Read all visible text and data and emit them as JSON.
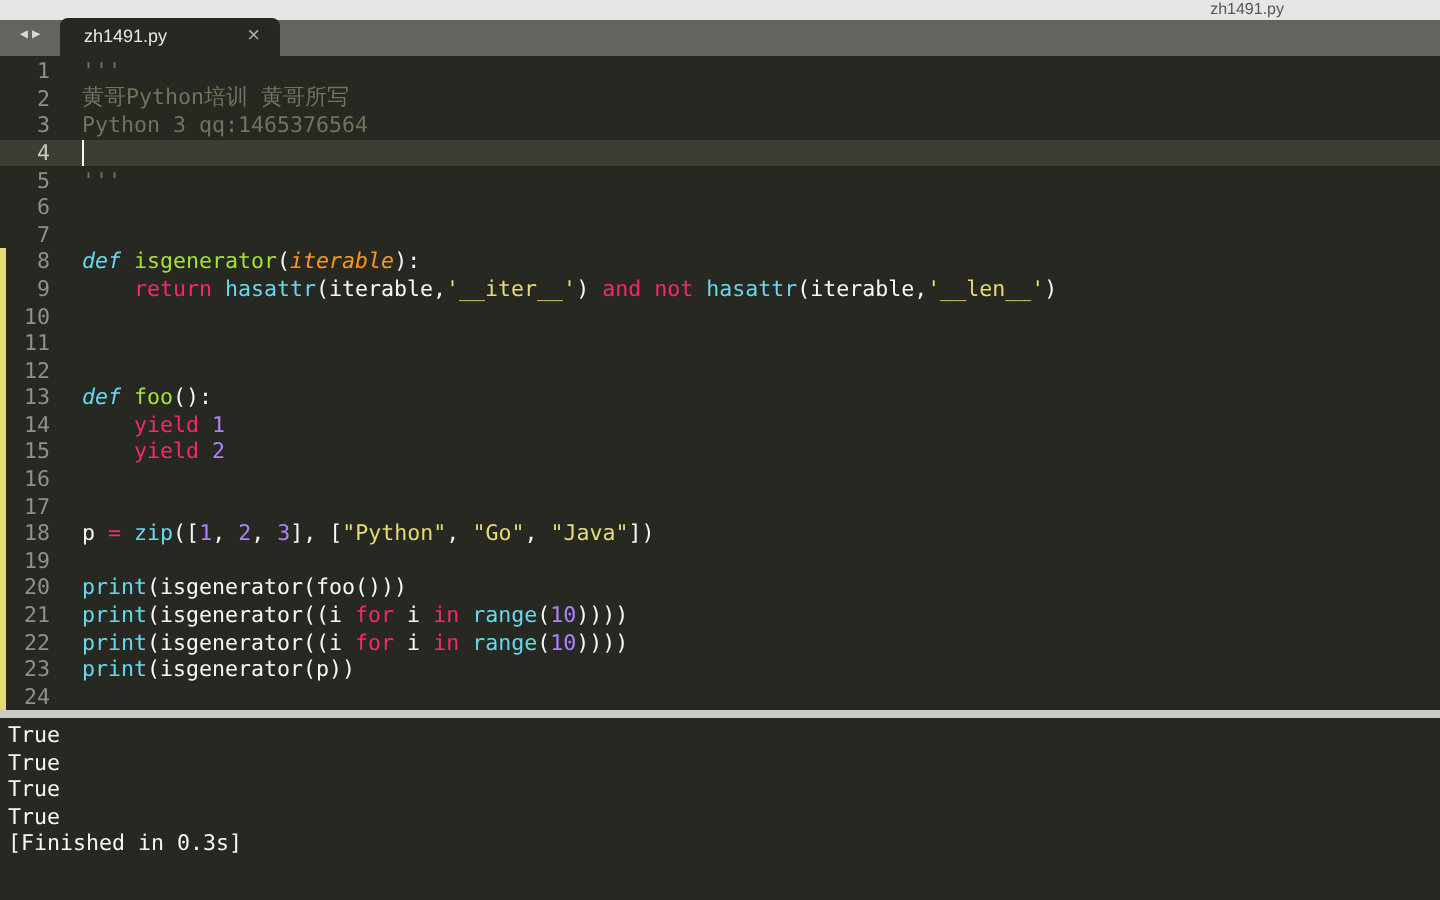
{
  "window": {
    "title": "zh1491.py"
  },
  "nav": {
    "back": "◀",
    "forward": "▶"
  },
  "tabs": [
    {
      "label": "zh1491.py",
      "close": "×",
      "selected": true
    }
  ],
  "editor": {
    "lines": [
      {
        "number": "1",
        "current": false,
        "modified": false,
        "tokens": [
          {
            "kind": "comment",
            "text": "'''"
          }
        ]
      },
      {
        "number": "2",
        "current": false,
        "modified": false,
        "tokens": [
          {
            "kind": "comment",
            "text": "黄哥Python培训 黄哥所写"
          }
        ]
      },
      {
        "number": "3",
        "current": false,
        "modified": false,
        "tokens": [
          {
            "kind": "comment",
            "text": "Python 3 qq:1465376564"
          }
        ]
      },
      {
        "number": "4",
        "current": true,
        "modified": false
      },
      {
        "number": "5",
        "current": false,
        "modified": false,
        "tokens": [
          {
            "kind": "comment",
            "text": "'''"
          }
        ]
      },
      {
        "number": "6",
        "current": false,
        "modified": false
      },
      {
        "number": "7",
        "current": false,
        "modified": false
      },
      {
        "number": "8",
        "current": false,
        "modified": true,
        "tokens": [
          {
            "kind": "storage",
            "text": "def "
          },
          {
            "kind": "function",
            "text": "isgenerator"
          },
          {
            "kind": "plain",
            "text": "("
          },
          {
            "kind": "param",
            "text": "iterable"
          },
          {
            "kind": "plain",
            "text": "):"
          }
        ]
      },
      {
        "number": "9",
        "current": false,
        "modified": true,
        "tokens": [
          {
            "kind": "keyword",
            "text": "    return "
          },
          {
            "kind": "builtin",
            "text": "hasattr"
          },
          {
            "kind": "plain",
            "text": "(iterable,"
          },
          {
            "kind": "string",
            "text": "'__iter__'"
          },
          {
            "kind": "plain",
            "text": ") "
          },
          {
            "kind": "keyword",
            "text": "and not "
          },
          {
            "kind": "builtin",
            "text": "hasattr"
          },
          {
            "kind": "plain",
            "text": "(iterable,"
          },
          {
            "kind": "string",
            "text": "'__len__'"
          },
          {
            "kind": "plain",
            "text": ")"
          }
        ]
      },
      {
        "number": "10",
        "current": false,
        "modified": true
      },
      {
        "number": "11",
        "current": false,
        "modified": true
      },
      {
        "number": "12",
        "current": false,
        "modified": true
      },
      {
        "number": "13",
        "current": false,
        "modified": true,
        "tokens": [
          {
            "kind": "storage",
            "text": "def "
          },
          {
            "kind": "function",
            "text": "foo"
          },
          {
            "kind": "plain",
            "text": "():"
          }
        ]
      },
      {
        "number": "14",
        "current": false,
        "modified": true,
        "tokens": [
          {
            "kind": "keyword",
            "text": "    yield "
          },
          {
            "kind": "number",
            "text": "1"
          }
        ]
      },
      {
        "number": "15",
        "current": false,
        "modified": true,
        "tokens": [
          {
            "kind": "keyword",
            "text": "    yield "
          },
          {
            "kind": "number",
            "text": "2"
          }
        ]
      },
      {
        "number": "16",
        "current": false,
        "modified": true
      },
      {
        "number": "17",
        "current": false,
        "modified": true
      },
      {
        "number": "18",
        "current": false,
        "modified": true,
        "tokens": [
          {
            "kind": "plain",
            "text": "p "
          },
          {
            "kind": "keyword",
            "text": "= "
          },
          {
            "kind": "builtin",
            "text": "zip"
          },
          {
            "kind": "plain",
            "text": "(["
          },
          {
            "kind": "number",
            "text": "1"
          },
          {
            "kind": "plain",
            "text": ", "
          },
          {
            "kind": "number",
            "text": "2"
          },
          {
            "kind": "plain",
            "text": ", "
          },
          {
            "kind": "number",
            "text": "3"
          },
          {
            "kind": "plain",
            "text": "], ["
          },
          {
            "kind": "string",
            "text": "\"Python\""
          },
          {
            "kind": "plain",
            "text": ", "
          },
          {
            "kind": "string",
            "text": "\"Go\""
          },
          {
            "kind": "plain",
            "text": ", "
          },
          {
            "kind": "string",
            "text": "\"Java\""
          },
          {
            "kind": "plain",
            "text": "])"
          }
        ]
      },
      {
        "number": "19",
        "current": false,
        "modified": true
      },
      {
        "number": "20",
        "current": false,
        "modified": true,
        "tokens": [
          {
            "kind": "builtin",
            "text": "print"
          },
          {
            "kind": "plain",
            "text": "(isgenerator(foo()))"
          }
        ]
      },
      {
        "number": "21",
        "current": false,
        "modified": true,
        "tokens": [
          {
            "kind": "builtin",
            "text": "print"
          },
          {
            "kind": "plain",
            "text": "(isgenerator((i "
          },
          {
            "kind": "keyword",
            "text": "for "
          },
          {
            "kind": "plain",
            "text": "i "
          },
          {
            "kind": "keyword",
            "text": "in "
          },
          {
            "kind": "builtin",
            "text": "range"
          },
          {
            "kind": "plain",
            "text": "("
          },
          {
            "kind": "number",
            "text": "10"
          },
          {
            "kind": "plain",
            "text": "))))"
          }
        ]
      },
      {
        "number": "22",
        "current": false,
        "modified": true,
        "tokens": [
          {
            "kind": "builtin",
            "text": "print"
          },
          {
            "kind": "plain",
            "text": "(isgenerator((i "
          },
          {
            "kind": "keyword",
            "text": "for "
          },
          {
            "kind": "plain",
            "text": "i "
          },
          {
            "kind": "keyword",
            "text": "in "
          },
          {
            "kind": "builtin",
            "text": "range"
          },
          {
            "kind": "plain",
            "text": "("
          },
          {
            "kind": "number",
            "text": "10"
          },
          {
            "kind": "plain",
            "text": "))))"
          }
        ]
      },
      {
        "number": "23",
        "current": false,
        "modified": true,
        "tokens": [
          {
            "kind": "builtin",
            "text": "print"
          },
          {
            "kind": "plain",
            "text": "(isgenerator(p))"
          }
        ]
      },
      {
        "number": "24",
        "current": false,
        "modified": true
      }
    ]
  },
  "output": {
    "lines": [
      "True",
      "True",
      "True",
      "True",
      "[Finished in 0.3s]"
    ]
  }
}
